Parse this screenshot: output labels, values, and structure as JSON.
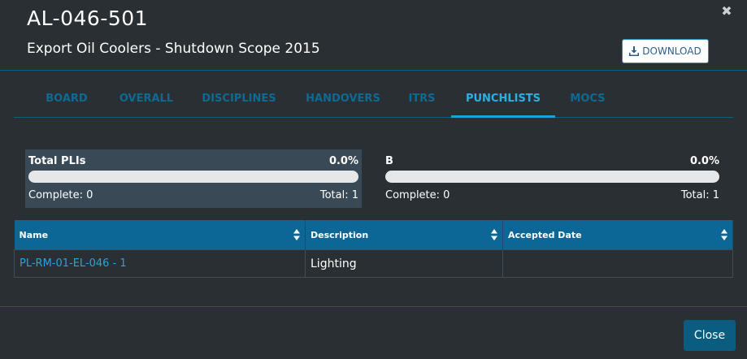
{
  "header": {
    "title": "AL-046-501",
    "subtitle": "Export Oil Coolers - Shutdown Scope 2015",
    "close_icon": "close-icon",
    "download_label": "DOWNLOAD",
    "download_icon": "download-icon"
  },
  "tabs": [
    {
      "label": "BOARD",
      "active": false
    },
    {
      "label": "OVERALL",
      "active": false
    },
    {
      "label": "DISCIPLINES",
      "active": false
    },
    {
      "label": "HANDOVERS",
      "active": false
    },
    {
      "label": "ITRS",
      "active": false
    },
    {
      "label": "PUNCHLISTS",
      "active": true
    },
    {
      "label": "MOCS",
      "active": false
    }
  ],
  "stats": [
    {
      "name": "Total PLIs",
      "percent_label": "0.0%",
      "progress_fraction": 0.0,
      "complete_label": "Complete: 0",
      "total_label": "Total: 1"
    },
    {
      "name": "B",
      "percent_label": "0.0%",
      "progress_fraction": 0.0,
      "complete_label": "Complete: 0",
      "total_label": "Total: 1"
    }
  ],
  "table": {
    "columns": [
      "Name",
      "Description",
      "Accepted Date"
    ],
    "sort_icon": "sort-icon",
    "rows": [
      {
        "name": "PL-RM-01-EL-046 - 1",
        "description": "Lighting",
        "accepted_date": ""
      }
    ]
  },
  "footer": {
    "close_label": "Close"
  },
  "colors": {
    "background": "#2a2f33",
    "accent": "#1aa3d9",
    "header_row": "#0d6796",
    "link": "#26a4db"
  }
}
